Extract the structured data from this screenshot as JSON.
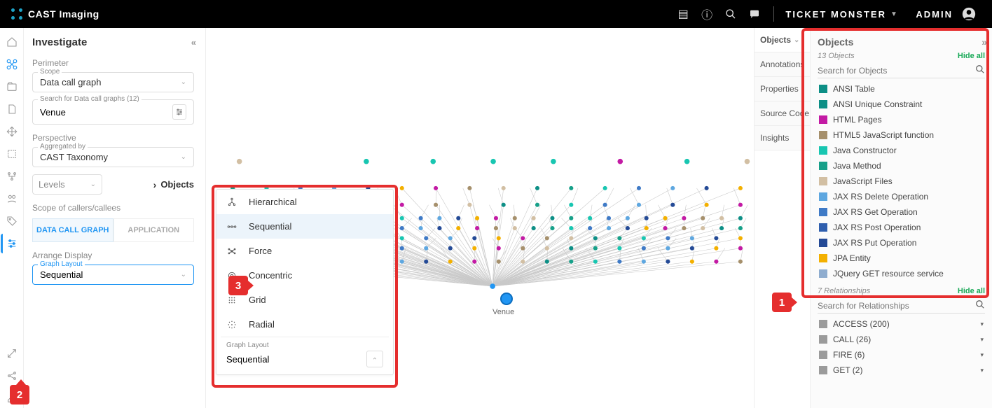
{
  "header": {
    "brand": "CAST Imaging",
    "context": "TICKET MONSTER",
    "user": "ADMIN"
  },
  "left": {
    "title": "Investigate",
    "perimeter_label": "Perimeter",
    "scope_label": "Scope",
    "scope_value": "Data call graph",
    "search_label": "Search for Data call graphs (12)",
    "search_value": "Venue",
    "perspective_label": "Perspective",
    "agg_label": "Aggregated by",
    "agg_value": "CAST Taxonomy",
    "levels": "Levels",
    "objects_link": "Objects",
    "callers_label": "Scope of callers/callees",
    "tab_active": "DATA CALL GRAPH",
    "tab_inactive": "APPLICATION",
    "arrange_label": "Arrange Display",
    "graph_layout_label": "Graph Layout",
    "graph_layout_value": "Sequential"
  },
  "popup": {
    "options": [
      "Hierarchical",
      "Sequential",
      "Force",
      "Concentric",
      "Grid",
      "Radial"
    ],
    "selected": "Sequential",
    "gl_label": "Graph Layout",
    "gl_value": "Sequential"
  },
  "canvas": {
    "center_node_label": "Venue"
  },
  "right_tabs": [
    "Objects",
    "Annotations",
    "Properties",
    "Source Code",
    "Insights"
  ],
  "objects_panel": {
    "title": "Objects",
    "count_label": "13 Objects",
    "hide": "Hide all",
    "search_ph": "Search for Objects",
    "items": [
      {
        "label": "ANSI Table",
        "color": "#0d8f86"
      },
      {
        "label": "ANSI Unique Constraint",
        "color": "#0d8f86"
      },
      {
        "label": "HTML Pages",
        "color": "#c31aa4"
      },
      {
        "label": "HTML5 JavaScript function",
        "color": "#a6906c"
      },
      {
        "label": "Java Constructor",
        "color": "#18c6b1"
      },
      {
        "label": "Java Method",
        "color": "#17a089"
      },
      {
        "label": "JavaScript Files",
        "color": "#d2bfa3"
      },
      {
        "label": "JAX RS Delete Operation",
        "color": "#5ea7e0"
      },
      {
        "label": "JAX RS Get Operation",
        "color": "#3f7ac6"
      },
      {
        "label": "JAX RS Post Operation",
        "color": "#2f5fae"
      },
      {
        "label": "JAX RS Put Operation",
        "color": "#244a96"
      },
      {
        "label": "JPA Entity",
        "color": "#f3b000"
      },
      {
        "label": "JQuery GET resource service",
        "color": "#8fadcf"
      }
    ],
    "rel_count_label": "7 Relationships",
    "rel_search_ph": "Search for Relationships",
    "relationships": [
      {
        "label": "ACCESS (200)"
      },
      {
        "label": "CALL (26)"
      },
      {
        "label": "FIRE (6)"
      },
      {
        "label": "GET (2)"
      }
    ]
  },
  "callouts": {
    "c1": "1",
    "c2": "2",
    "c3": "3"
  }
}
